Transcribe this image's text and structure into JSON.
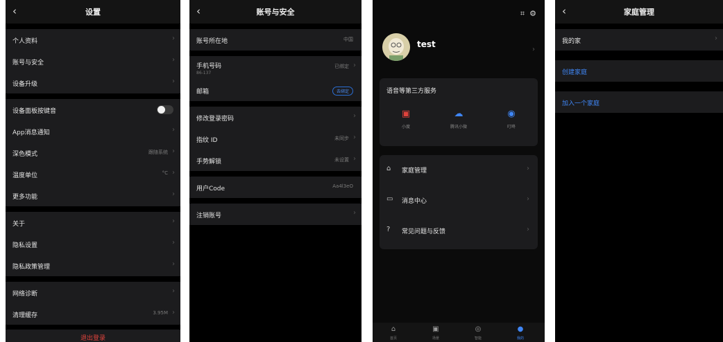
{
  "settings": {
    "title": "设置",
    "back": "‹",
    "items": [
      {
        "label": "个人资料"
      },
      {
        "label": "账号与安全"
      },
      {
        "label": "设备升级"
      },
      {
        "label": "设备面板按键音"
      },
      {
        "label": "App消息通知"
      },
      {
        "label": "深色模式",
        "value": "跟随系统"
      },
      {
        "label": "温度单位",
        "value": "°C"
      },
      {
        "label": "更多功能"
      },
      {
        "label": "关于"
      },
      {
        "label": "隐私设置"
      },
      {
        "label": "隐私政策管理"
      },
      {
        "label": "网络诊断"
      },
      {
        "label": "清理缓存",
        "value": "3.95M"
      }
    ],
    "logout": "退出登录"
  },
  "account": {
    "title": "账号与安全",
    "back": "‹",
    "region_label": "账号所在地",
    "region_value": "中国",
    "phone_label": "手机号码",
    "phone_number": "86-137",
    "phone_status": "已绑定",
    "email_label": "邮箱",
    "email_badge": "去绑定",
    "change_password": "修改登录密码",
    "fingerprint_label": "指纹 ID",
    "fingerprint_value": "未同步",
    "gesture_label": "手势解锁",
    "gesture_value": "未设置",
    "usercode_label": "用户Code",
    "usercode_value": "Aa4l3eO",
    "delete_account": "注销账号"
  },
  "profile": {
    "username": "test",
    "scan_icon": "scan-icon",
    "settings_icon": "gear-icon",
    "services_title": "语音等第三方服务",
    "services": [
      {
        "label": "小度",
        "icon": "xiaodu-icon",
        "color": "#e0433c"
      },
      {
        "label": "腾讯小微",
        "icon": "cloud-icon",
        "color": "#3f86f5"
      },
      {
        "label": "叮咚",
        "icon": "dingdong-icon",
        "color": "#3f86f5"
      }
    ],
    "menu": [
      {
        "label": "家庭管理",
        "icon": "home-icon"
      },
      {
        "label": "消息中心",
        "icon": "message-icon"
      },
      {
        "label": "常见问题与反馈",
        "icon": "help-icon"
      }
    ],
    "tabs": [
      {
        "label": "首页",
        "icon": "home-tab-icon"
      },
      {
        "label": "场景",
        "icon": "scene-tab-icon"
      },
      {
        "label": "智能",
        "icon": "smart-tab-icon"
      },
      {
        "label": "我的",
        "icon": "me-tab-icon",
        "active": true
      }
    ]
  },
  "family": {
    "title": "家庭管理",
    "back": "‹",
    "my_home": "我的家",
    "create_home": "创建家庭",
    "join_home": "加入一个家庭"
  }
}
